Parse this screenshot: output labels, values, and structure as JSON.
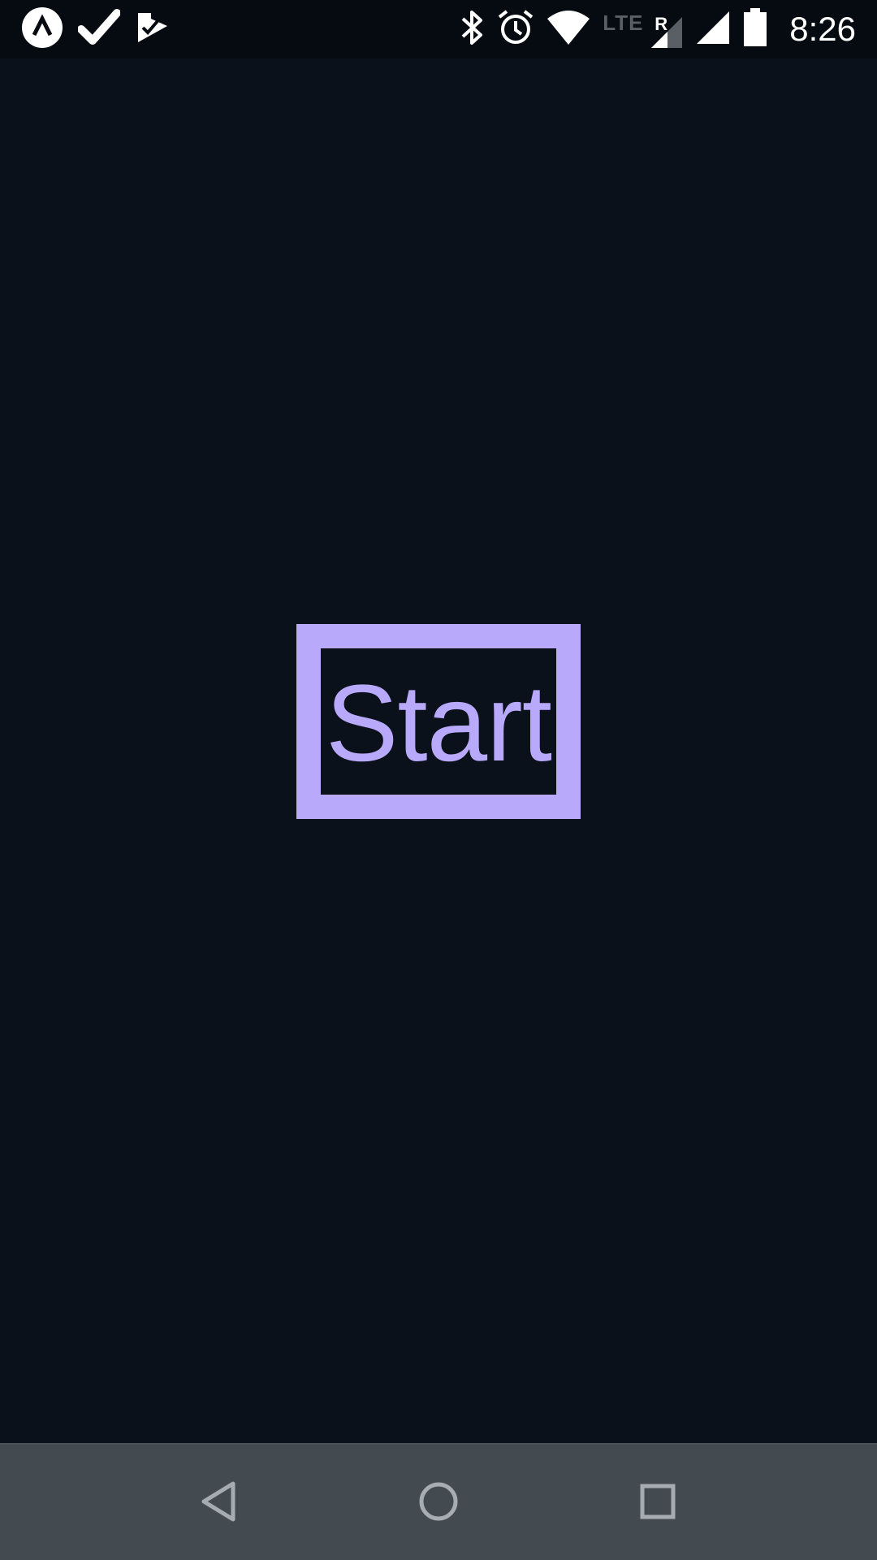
{
  "status_bar": {
    "time": "8:26",
    "network_label": "LTE",
    "roaming_label": "R",
    "left_icons": [
      "app-notification-icon",
      "check-icon",
      "task-check-icon"
    ],
    "right_icons": [
      "bluetooth-icon",
      "alarm-icon",
      "wifi-icon",
      "lte-signal-icon",
      "signal-icon",
      "battery-icon"
    ]
  },
  "main": {
    "start_label": "Start"
  },
  "nav_bar": {
    "buttons": [
      "back-icon",
      "home-icon",
      "recents-icon"
    ]
  },
  "colors": {
    "background": "#0a111a",
    "status_bar": "#060b11",
    "accent": "#b9a9fa",
    "nav_bar": "#434a50",
    "nav_icon": "#a7acb0"
  }
}
